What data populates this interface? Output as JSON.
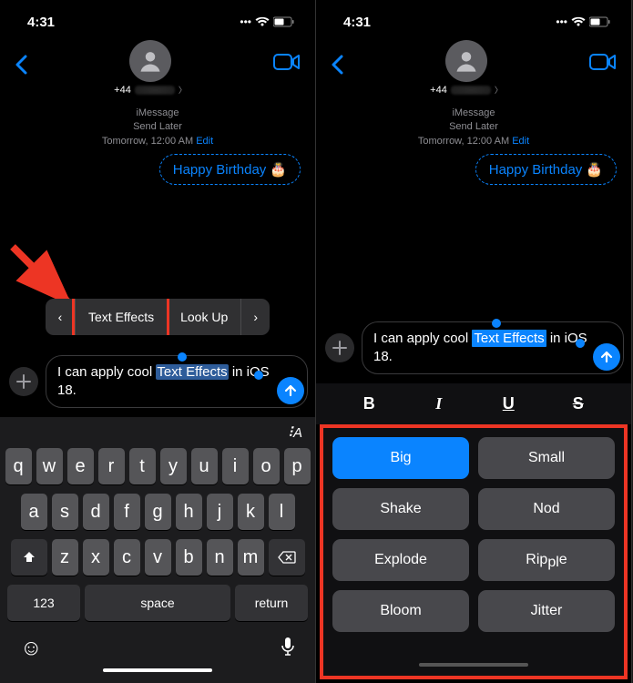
{
  "status": {
    "time": "4:31"
  },
  "contact": {
    "number": "+44"
  },
  "schedule": {
    "service": "iMessage",
    "mode": "Send Later",
    "when": "Tomorrow, 12:00 AM",
    "edit": "Edit"
  },
  "bubble": {
    "text": "Happy Birthday",
    "emoji": "🎂"
  },
  "context_menu": {
    "prev": "‹",
    "items": [
      "Text Effects",
      "Look Up"
    ],
    "next": "›"
  },
  "compose": {
    "pre": "I  can apply cool ",
    "selected": "Text Effects",
    "post": " in iOS 18."
  },
  "keyboard": {
    "row1": [
      "q",
      "w",
      "e",
      "r",
      "t",
      "y",
      "u",
      "i",
      "o",
      "p"
    ],
    "row2": [
      "a",
      "s",
      "d",
      "f",
      "g",
      "h",
      "j",
      "k",
      "l"
    ],
    "row3": [
      "z",
      "x",
      "c",
      "v",
      "b",
      "n",
      "m"
    ],
    "numbers": "123",
    "space": "space",
    "return": "return",
    "font": "⠸A"
  },
  "format": {
    "bold": "B",
    "italic": "I",
    "underline": "U",
    "strike": "S"
  },
  "effects": [
    "Big",
    "Small",
    "Shake",
    "Nod",
    "Explode",
    "Ripple",
    "Bloom",
    "Jitter"
  ],
  "active_effect": "Big"
}
